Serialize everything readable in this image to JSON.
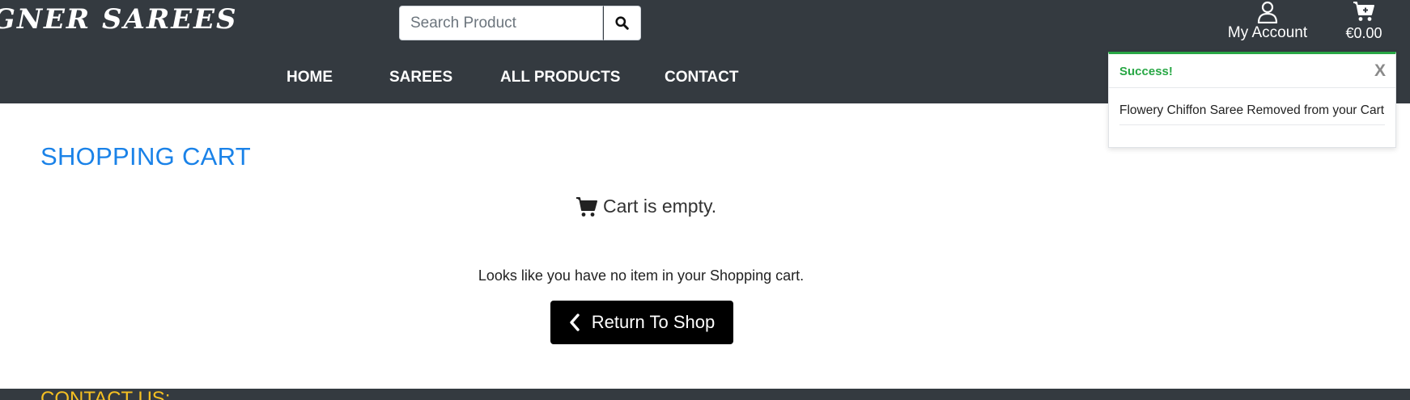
{
  "header": {
    "logo_text": "IGNER SAREES",
    "search": {
      "placeholder": "Search Product",
      "value": ""
    },
    "search_button_icon": "search-icon",
    "account": {
      "icon": "user-icon",
      "label": "My Account"
    },
    "cart": {
      "icon": "cart-plus-icon",
      "total": "€0.00"
    }
  },
  "nav": {
    "items": [
      {
        "label": "HOME"
      },
      {
        "label": "SAREES"
      },
      {
        "label": "ALL PRODUCTS"
      },
      {
        "label": "CONTACT"
      }
    ]
  },
  "main": {
    "title": "SHOPPING CART",
    "empty_icon": "cart-icon",
    "empty_text": "Cart is empty.",
    "empty_description": "Looks like you have no item in your Shopping cart.",
    "return_button": {
      "icon": "chevron-left-icon",
      "label": "Return To Shop"
    }
  },
  "footer": {
    "title": "CONTACT US:"
  },
  "toast": {
    "title": "Success!",
    "close_label": "X",
    "message": "Flowery Chiffon Saree Removed from your Cart"
  },
  "colors": {
    "header_bg": "#343a40",
    "title_blue": "#1a82e8",
    "success_green": "#28a745",
    "footer_title": "#f5c022",
    "button_bg": "#000000"
  }
}
